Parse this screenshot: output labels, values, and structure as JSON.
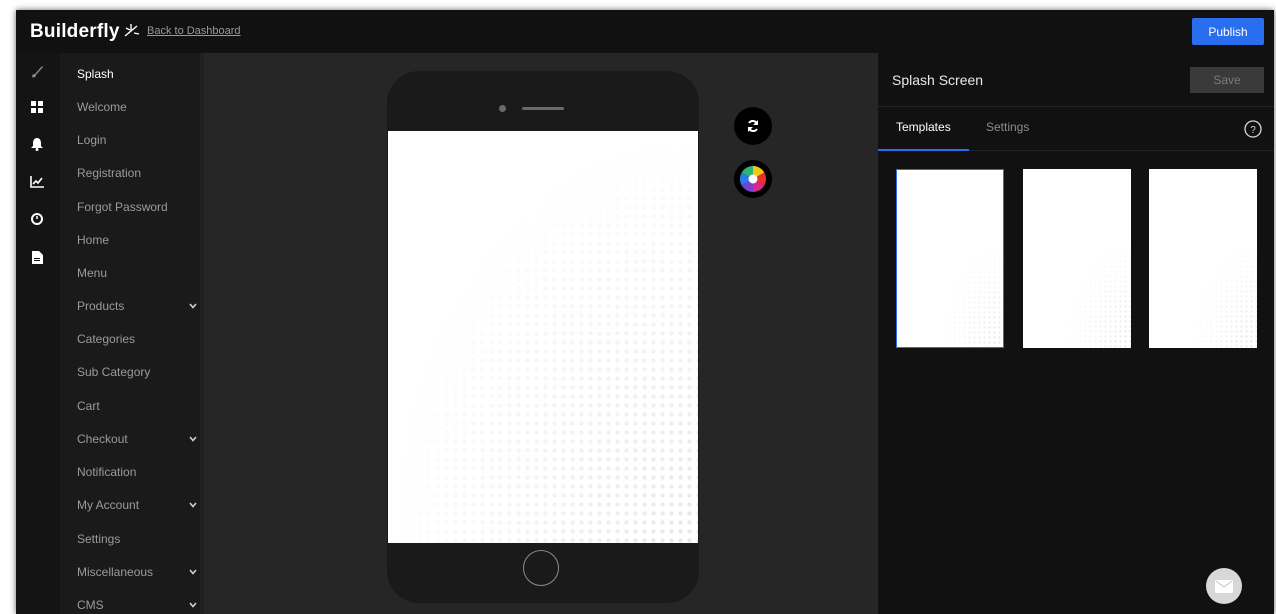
{
  "app": {
    "brand": "Builderfly",
    "back_link": "Back to Dashboard",
    "publish_label": "Publish",
    "accent_color": "#2a6ef0"
  },
  "rail": {
    "icons": [
      "brush-icon",
      "grid-icon",
      "bell-icon",
      "chart-icon",
      "clock-icon",
      "document-icon"
    ]
  },
  "nav": {
    "items": [
      {
        "label": "Splash",
        "active": true,
        "has_submenu": false
      },
      {
        "label": "Welcome",
        "active": false,
        "has_submenu": false
      },
      {
        "label": "Login",
        "active": false,
        "has_submenu": false
      },
      {
        "label": "Registration",
        "active": false,
        "has_submenu": false
      },
      {
        "label": "Forgot Password",
        "active": false,
        "has_submenu": false
      },
      {
        "label": "Home",
        "active": false,
        "has_submenu": false
      },
      {
        "label": "Menu",
        "active": false,
        "has_submenu": false
      },
      {
        "label": "Products",
        "active": false,
        "has_submenu": true
      },
      {
        "label": "Categories",
        "active": false,
        "has_submenu": false
      },
      {
        "label": "Sub Category",
        "active": false,
        "has_submenu": false
      },
      {
        "label": "Cart",
        "active": false,
        "has_submenu": false
      },
      {
        "label": "Checkout",
        "active": false,
        "has_submenu": true
      },
      {
        "label": "Notification",
        "active": false,
        "has_submenu": false
      },
      {
        "label": "My Account",
        "active": false,
        "has_submenu": true
      },
      {
        "label": "Settings",
        "active": false,
        "has_submenu": false
      },
      {
        "label": "Miscellaneous",
        "active": false,
        "has_submenu": true
      },
      {
        "label": "CMS",
        "active": false,
        "has_submenu": true
      }
    ]
  },
  "canvas": {
    "tools": [
      "refresh-icon",
      "color-wheel-icon"
    ]
  },
  "panel": {
    "title": "Splash Screen",
    "save_label": "Save",
    "tabs": [
      {
        "label": "Templates",
        "active": true
      },
      {
        "label": "Settings",
        "active": false
      }
    ],
    "help_icon": "help-icon",
    "templates": [
      {
        "selected": true
      },
      {
        "selected": false
      },
      {
        "selected": false
      }
    ]
  },
  "support": {
    "icon": "mail-icon"
  }
}
